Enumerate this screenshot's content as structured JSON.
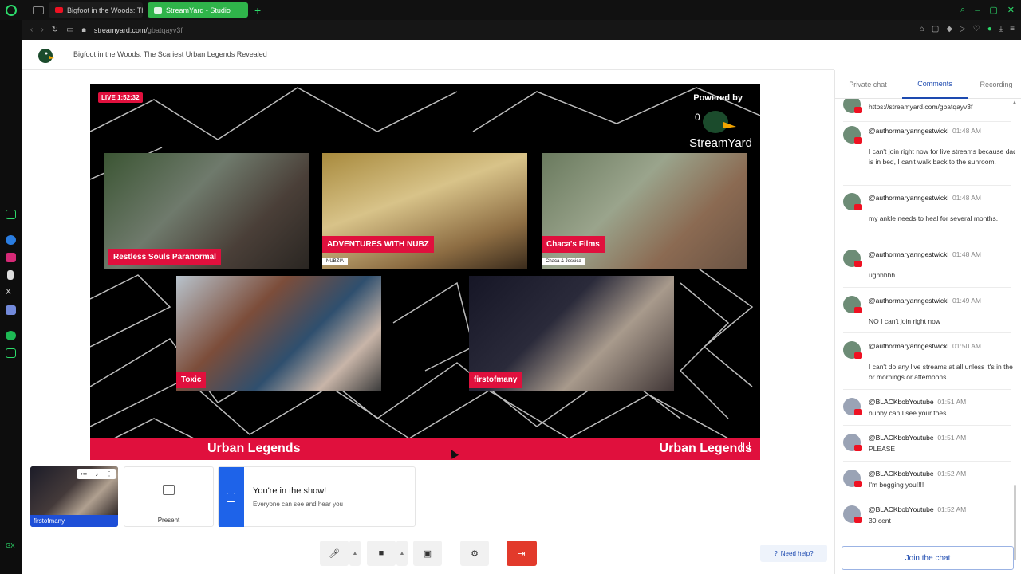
{
  "browser": {
    "tabs": [
      {
        "title": "Bigfoot in the Woods: The",
        "icon": "youtube-icon"
      },
      {
        "title": "StreamYard - Studio",
        "icon": "streamyard-icon"
      }
    ],
    "url_domain": "streamyard.com/",
    "url_path": "gbatqayv3f",
    "accent": "#2ddc6b"
  },
  "page": {
    "title": "Bigfoot in the Woods: The Scariest Urban Legends Revealed"
  },
  "stage": {
    "live_badge": "LIVE 1:52:32",
    "powered_by": "Powered by",
    "brand": "StreamYard",
    "feeds": [
      {
        "name": "Restless Souls Paranormal",
        "sub": ""
      },
      {
        "name": "ADVENTURES WITH NUBZ",
        "sub": "NUBZIA"
      },
      {
        "name": "Chaca's Films",
        "sub": "Chaca & Jessica"
      },
      {
        "name": "Toxic",
        "sub": ""
      },
      {
        "name": "firstofmany",
        "sub": ""
      }
    ],
    "banner_left": "Urban Legends",
    "banner_right": "Urban Legends",
    "accent": "#e0103d"
  },
  "bottom": {
    "self_name": "firstofmany",
    "present_label": "Present",
    "in_show_title": "You're in the show!",
    "in_show_sub": "Everyone can see and hear you",
    "help_label": "Need help?"
  },
  "panel": {
    "tabs": [
      "Private chat",
      "Comments",
      "Recording"
    ],
    "active_tab": "Comments",
    "comments": [
      {
        "user": "",
        "time": "",
        "text": "https://streamyard.com/gbatqayv3f"
      },
      {
        "user": "@authormaryanngestwicki",
        "time": "01:48 AM",
        "text": "I can't join right now for live streams because dad is in bed, I can't walk back to the sunroom."
      },
      {
        "user": "@authormaryanngestwicki",
        "time": "01:48 AM",
        "text": "my ankle needs to heal for several months."
      },
      {
        "user": "@authormaryanngestwicki",
        "time": "01:48 AM",
        "text": "ughhhhh"
      },
      {
        "user": "@authormaryanngestwicki",
        "time": "01:49 AM",
        "text": "NO I can't join right now"
      },
      {
        "user": "@authormaryanngestwicki",
        "time": "01:50 AM",
        "text": "I can't do any live streams at all unless it's in the or mornings or afternoons."
      },
      {
        "user": "@BLACKbobYoutube",
        "time": "01:51 AM",
        "text": "nubby can I see your toes"
      },
      {
        "user": "@BLACKbobYoutube",
        "time": "01:51 AM",
        "text": "PLEASE"
      },
      {
        "user": "@BLACKbobYoutube",
        "time": "01:52 AM",
        "text": "I'm begging you!!!!"
      },
      {
        "user": "@BLACKbobYoutube",
        "time": "01:52 AM",
        "text": "30 cent"
      }
    ],
    "join_label": "Join the chat"
  }
}
